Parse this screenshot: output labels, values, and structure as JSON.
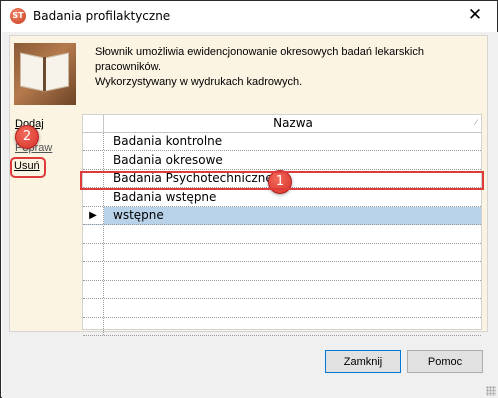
{
  "window": {
    "title": "Badania profilaktyczne",
    "app_icon_text": "ST",
    "close_glyph": "✕"
  },
  "description": {
    "line1": "Słownik umożliwia ewidencjonowanie okresowych badań lekarskich pracowników.",
    "line2": "Wykorzystywany w wydrukach kadrowych."
  },
  "sidebar": {
    "add_label": "Dodaj",
    "edit_label": "Popraw",
    "delete_label": "Usuń"
  },
  "grid": {
    "column_header": "Nazwa",
    "sort_glyph": "∕",
    "selected_row_marker": "▶",
    "rows": [
      "Badania kontrolne",
      "Badania okresowe",
      "Badania Psychotechniczne",
      "Badania wstępne",
      "wstępne",
      "",
      "",
      "",
      "",
      "",
      ""
    ],
    "selected_index": 4
  },
  "annotations": {
    "badge_1": "1",
    "badge_2": "2",
    "highlight_color": "#e03b3b"
  },
  "buttons": {
    "close_label": "Zamknij",
    "help_label": "Pomoc"
  },
  "colors": {
    "panel_background": "#fbf4e3",
    "selection": "#b8d2ea"
  }
}
